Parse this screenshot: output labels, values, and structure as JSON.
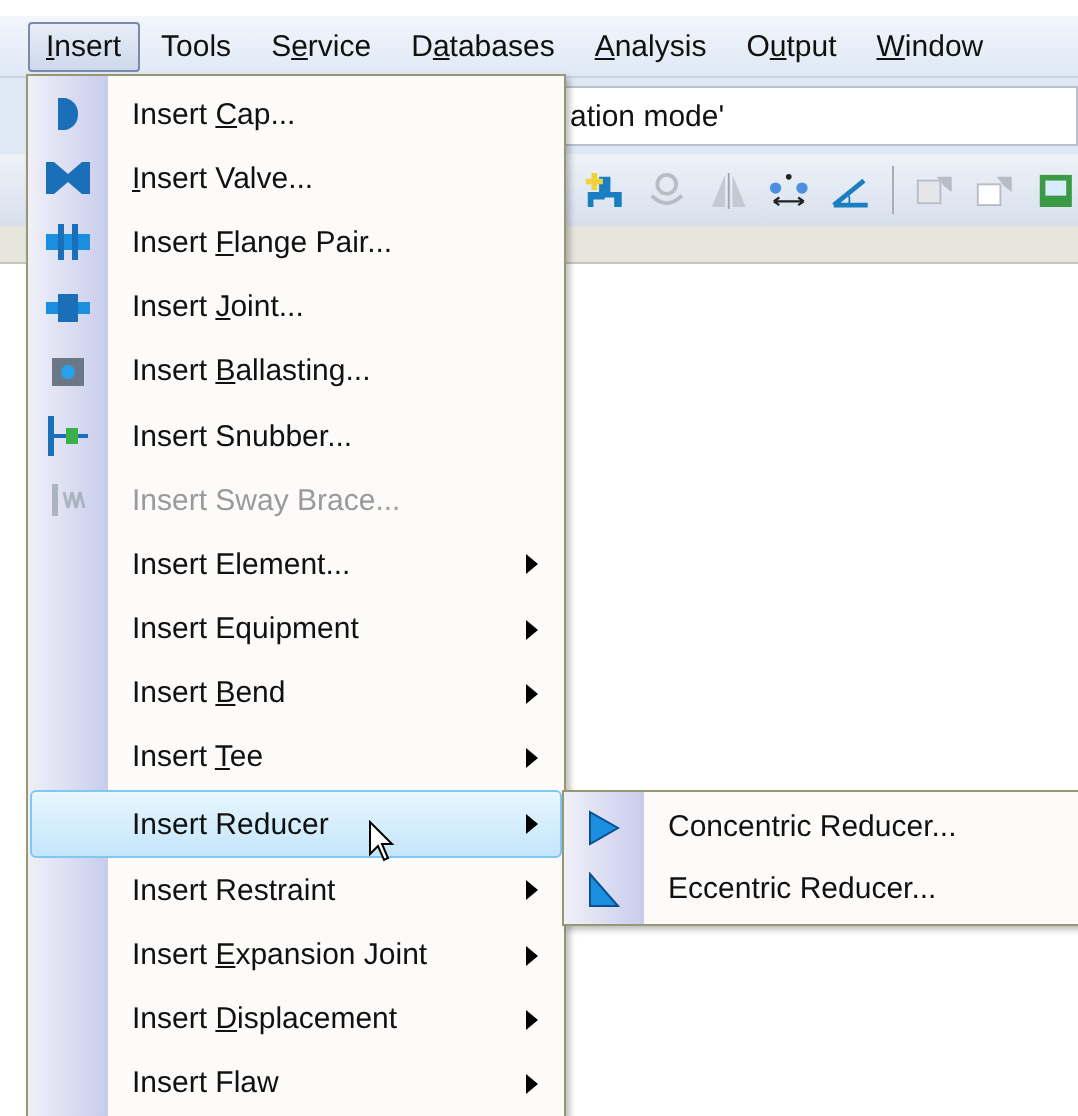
{
  "menubar": [
    {
      "key": "I",
      "post": "nsert",
      "selected": true
    },
    {
      "pre": "Tools",
      "selected": false
    },
    {
      "pre": "S",
      "key": "e",
      "post": "rvice",
      "selected": false
    },
    {
      "pre": "D",
      "key": "a",
      "post": "tabases",
      "selected": false
    },
    {
      "key": "A",
      "post": "nalysis",
      "selected": false
    },
    {
      "pre": "O",
      "key": "u",
      "post": "tput",
      "selected": false
    },
    {
      "key": "W",
      "post": "indow",
      "selected": false
    }
  ],
  "mode_field": {
    "value": "ation mode'"
  },
  "menu": [
    {
      "kind": "cap",
      "pre": "Insert ",
      "key": "C",
      "post": "ap...",
      "disabled": false,
      "submenu": false,
      "selected": false
    },
    {
      "kind": "valve",
      "key": "I",
      "post": "nsert Valve...",
      "disabled": false,
      "submenu": false,
      "selected": false
    },
    {
      "kind": "flange",
      "pre": "Insert ",
      "key": "F",
      "post": "lange Pair...",
      "disabled": false,
      "submenu": false,
      "selected": false
    },
    {
      "kind": "joint",
      "pre": "Insert ",
      "key": "J",
      "post": "oint...",
      "disabled": false,
      "submenu": false,
      "selected": false
    },
    {
      "kind": "ballast",
      "pre": "Insert ",
      "key": "B",
      "post": "allasting...",
      "disabled": false,
      "submenu": false,
      "selected": false
    },
    {
      "kind": "snubber",
      "pre": "Insert Snubber...",
      "disabled": false,
      "submenu": false,
      "selected": false
    },
    {
      "kind": "sway",
      "pre": "Insert Sway Brace...",
      "disabled": true,
      "submenu": false,
      "selected": false
    },
    {
      "kind": "none",
      "pre": "Insert Element...",
      "disabled": false,
      "submenu": true,
      "selected": false
    },
    {
      "kind": "none",
      "pre": "Insert Equipment",
      "disabled": false,
      "submenu": true,
      "selected": false
    },
    {
      "kind": "none",
      "pre": "Insert ",
      "key": "B",
      "post": "end",
      "disabled": false,
      "submenu": true,
      "selected": false
    },
    {
      "kind": "none",
      "pre": "Insert ",
      "key": "T",
      "post": "ee",
      "disabled": false,
      "submenu": true,
      "selected": false
    },
    {
      "kind": "none",
      "pre": "Insert Reducer",
      "disabled": false,
      "submenu": true,
      "selected": true
    },
    {
      "kind": "none",
      "pre": "Insert Restraint",
      "disabled": false,
      "submenu": true,
      "selected": false
    },
    {
      "kind": "none",
      "pre": "Insert ",
      "key": "E",
      "post": "xpansion Joint",
      "disabled": false,
      "submenu": true,
      "selected": false
    },
    {
      "kind": "none",
      "pre": "Insert ",
      "key": "D",
      "post": "isplacement",
      "disabled": false,
      "submenu": true,
      "selected": false
    },
    {
      "kind": "none",
      "pre": "Insert Flaw",
      "disabled": false,
      "submenu": true,
      "selected": false
    }
  ],
  "submenu": [
    {
      "kind": "concentric",
      "label": "Concentric Reducer..."
    },
    {
      "kind": "eccentric",
      "label": "Eccentric Reducer..."
    }
  ]
}
